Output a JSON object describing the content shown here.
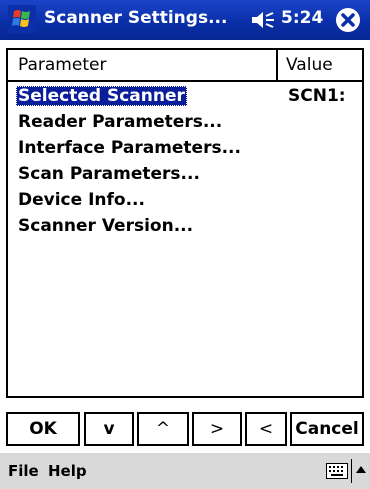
{
  "window": {
    "title": "Scanner Settings...",
    "time": "5:24"
  },
  "list": {
    "columns": [
      "Parameter",
      "Value"
    ],
    "rows": [
      {
        "label": "Selected Scanner",
        "value": "SCN1:",
        "selected": true
      },
      {
        "label": "Reader Parameters...",
        "value": ""
      },
      {
        "label": "Interface Parameters...",
        "value": ""
      },
      {
        "label": "Scan Parameters...",
        "value": ""
      },
      {
        "label": "Device Info...",
        "value": ""
      },
      {
        "label": "Scanner Version...",
        "value": ""
      }
    ]
  },
  "buttons": {
    "ok": "OK",
    "down": "v",
    "up": "^",
    "right": ">",
    "left": "<",
    "cancel": "Cancel"
  },
  "menu": {
    "file": "File",
    "help": "Help"
  },
  "icons": {
    "start": "windows-flag-icon",
    "volume": "speaker-icon",
    "close": "close-icon",
    "keyboard": "keyboard-icon",
    "sip": "arrow-up-icon"
  },
  "colors": {
    "titlebar": "#0a2fa8",
    "selection": "#0a1e9c",
    "menubar": "#d9d9d9"
  }
}
